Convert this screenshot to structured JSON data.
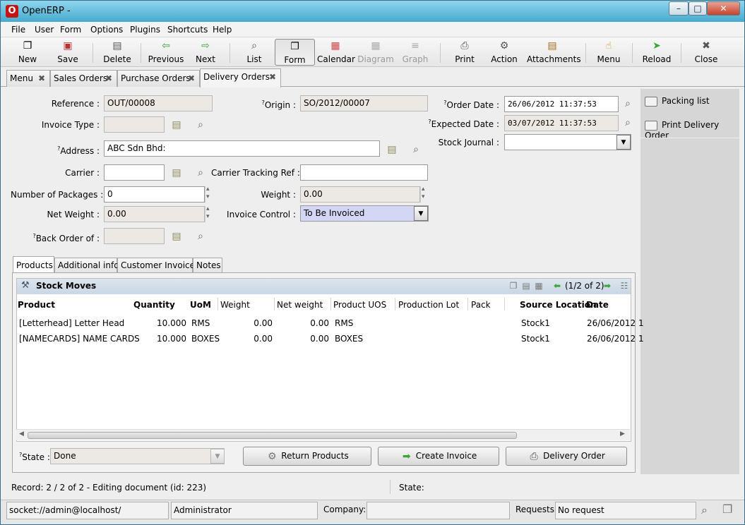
{
  "window": {
    "title": "OpenERP -",
    "logo": "O",
    "minimize_glyph": "–",
    "maximize_glyph": "□",
    "close_glyph": "✕"
  },
  "menu": [
    "File",
    "User",
    "Form",
    "Options",
    "Plugins",
    "Shortcuts",
    "Help"
  ],
  "toolbar": {
    "new": {
      "label": "New",
      "icon": "❐"
    },
    "save": {
      "label": "Save",
      "icon": "▣"
    },
    "delete": {
      "label": "Delete",
      "icon": "▤"
    },
    "previous": {
      "label": "Previous",
      "icon": "⇦"
    },
    "next": {
      "label": "Next",
      "icon": "⇨"
    },
    "list": {
      "label": "List",
      "icon": "⌕"
    },
    "form": {
      "label": "Form",
      "icon": "❐"
    },
    "calendar": {
      "label": "Calendar",
      "icon": "▦"
    },
    "diagram": {
      "label": "Diagram",
      "icon": "▦"
    },
    "graph": {
      "label": "Graph",
      "icon": "≡"
    },
    "print": {
      "label": "Print",
      "icon": "⎙"
    },
    "action": {
      "label": "Action",
      "icon": "⚙"
    },
    "attachments": {
      "label": "Attachments",
      "icon": "▤"
    },
    "menu": {
      "label": "Menu",
      "icon": "☝"
    },
    "reload": {
      "label": "Reload",
      "icon": "➤"
    },
    "close": {
      "label": "Close",
      "icon": "✖"
    }
  },
  "tabs": [
    {
      "label": "Menu"
    },
    {
      "label": "Sales Orders"
    },
    {
      "label": "Purchase Orders"
    },
    {
      "label": "Delivery Orders"
    }
  ],
  "tab_close_glyph": "✖",
  "form": {
    "reference": {
      "label": "Reference :",
      "value": "OUT/00008"
    },
    "origin": {
      "label": "Origin :",
      "help": "?",
      "value": "SO/2012/00007"
    },
    "order_date": {
      "label": "Order Date :",
      "help": "?",
      "value": "26/06/2012 11:37:53"
    },
    "expected_date": {
      "label": "Expected Date :",
      "help": "?",
      "value": "03/07/2012 11:37:53"
    },
    "invoice_type": {
      "label": "Invoice Type :",
      "value": ""
    },
    "stock_journal": {
      "label": "Stock Journal :",
      "value": ""
    },
    "address": {
      "label": "Address :",
      "help": "?",
      "value": "ABC Sdn Bhd:"
    },
    "carrier": {
      "label": "Carrier :",
      "value": ""
    },
    "carrier_tracking_ref": {
      "label": "Carrier Tracking Ref :",
      "value": ""
    },
    "number_of_packages": {
      "label": "Number of Packages :",
      "value": "0"
    },
    "weight": {
      "label": "Weight :",
      "value": "0.00"
    },
    "net_weight": {
      "label": "Net Weight :",
      "value": "0.00"
    },
    "invoice_control": {
      "label": "Invoice Control :",
      "value": "To Be Invoiced"
    },
    "back_order_of": {
      "label": "Back Order of :",
      "help": "?",
      "value": ""
    }
  },
  "side_actions": [
    {
      "label": "Packing list"
    },
    {
      "label": "Print Delivery Order"
    }
  ],
  "subtabs": [
    {
      "label": "Products"
    },
    {
      "label": "Additional info"
    },
    {
      "label": "Customer Invoices"
    },
    {
      "label": "Notes"
    }
  ],
  "grid": {
    "title": "Stock Moves",
    "pager": "(1/2 of 2)",
    "columns": [
      "Product",
      "Quantity",
      "UoM",
      "Weight",
      "Net weight",
      "Product UOS",
      "Production Lot",
      "Pack",
      "Source Location",
      "Date"
    ],
    "rows": [
      {
        "product": "[Letterhead] Letter Head",
        "quantity": "10.000",
        "uom": "RMS",
        "weight": "0.00",
        "net_weight": "0.00",
        "product_uos": "RMS",
        "production_lot": "",
        "pack": "",
        "source_location": "Stock1",
        "date": "26/06/2012 1"
      },
      {
        "product": "[NAMECARDS] NAME CARDS",
        "quantity": "10.000",
        "uom": "BOXES",
        "weight": "0.00",
        "net_weight": "0.00",
        "product_uos": "BOXES",
        "production_lot": "",
        "pack": "",
        "source_location": "Stock1",
        "date": "26/06/2012 1"
      }
    ]
  },
  "state": {
    "label": "State :",
    "help": "?",
    "value": "Done"
  },
  "buttons": {
    "return_products": "Return Products",
    "create_invoice": "Create Invoice",
    "delivery_order": "Delivery Order"
  },
  "status": {
    "record": "Record: 2 / 2 of 2 - Editing document (id: 223)",
    "state_label": "State:"
  },
  "bottom": {
    "connection": "socket://admin@localhost/",
    "user": "Administrator",
    "company_label": "Company:",
    "company_value": "",
    "requests_label": "Requests:",
    "requests_value": "No request"
  },
  "colors": {
    "title_gradient_top": "#8fd6ee",
    "required_field": "#d3d6f4",
    "readonly_field": "#ece9e4",
    "grid_header": "#c9d6e4",
    "next_arrow_green": "#3aa63a"
  }
}
